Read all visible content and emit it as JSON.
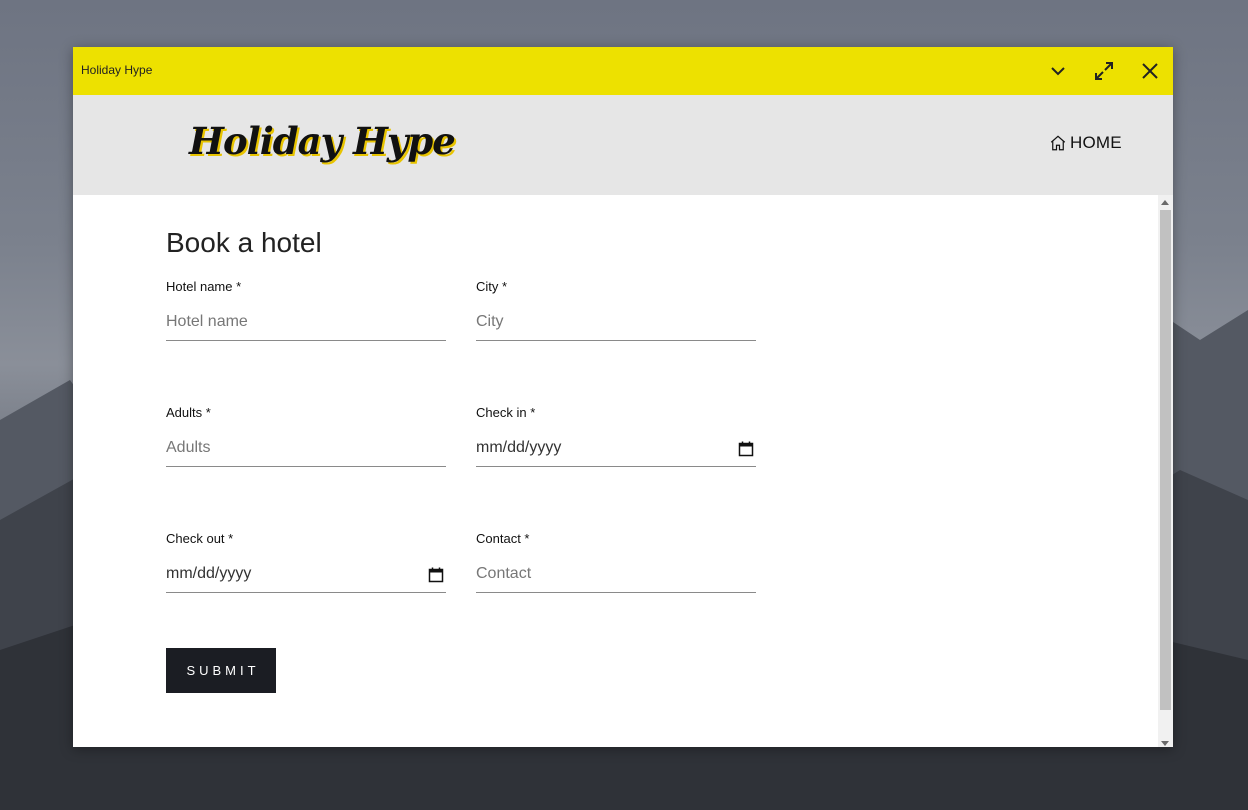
{
  "window": {
    "title": "Holiday Hype",
    "accent_color": "#ede100",
    "controls": {
      "minimize_icon": "chevron-down-icon",
      "maximize_icon": "expand-icon",
      "close_icon": "close-icon"
    }
  },
  "header": {
    "logo_text": "Holiday Hype",
    "nav": {
      "home_icon": "home-icon",
      "home_label": "HOME"
    }
  },
  "form": {
    "title": "Book a hotel",
    "fields": {
      "hotel_name": {
        "label": "Hotel name *",
        "placeholder": "Hotel name"
      },
      "city": {
        "label": "City *",
        "placeholder": "City"
      },
      "adults": {
        "label": "Adults *",
        "placeholder": "Adults"
      },
      "check_in": {
        "label": "Check in *",
        "value": "mm/dd/yyyy",
        "icon": "calendar-icon"
      },
      "check_out": {
        "label": "Check out *",
        "value": "mm/dd/yyyy",
        "icon": "calendar-icon"
      },
      "contact": {
        "label": "Contact *",
        "placeholder": "Contact"
      }
    },
    "submit_label": "SUBMIT",
    "submit_color": "#1b1d23"
  }
}
